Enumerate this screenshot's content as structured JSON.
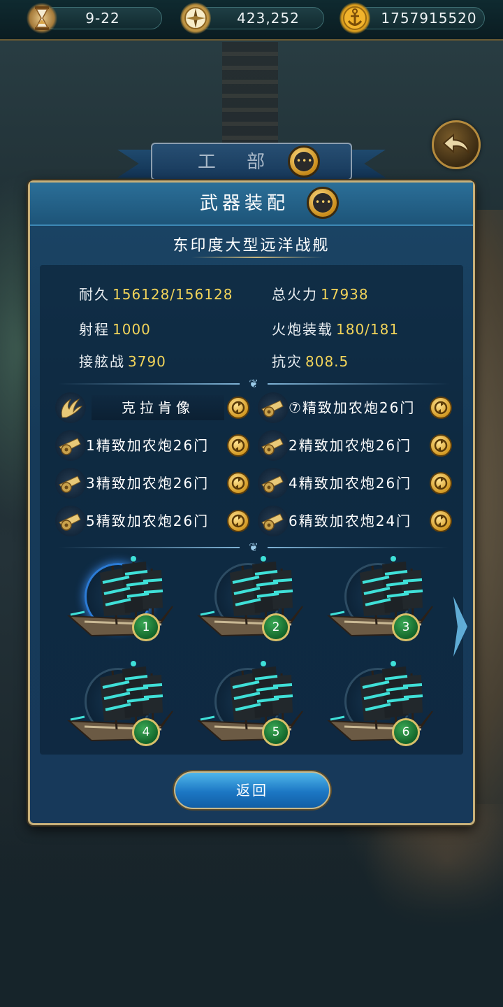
{
  "topbar": {
    "date": "9-22",
    "gold": "423,252",
    "anchors": "1757915520"
  },
  "department": {
    "title": "工 部"
  },
  "panel": {
    "title": "武器装配",
    "ship_name": "东印度大型远洋战舰",
    "stats": {
      "durability_label": "耐久",
      "durability_value": "156128/156128",
      "firepower_label": "总火力",
      "firepower_value": "17938",
      "range_label": "射程",
      "range_value": "1000",
      "cannon_label": "火炮装载",
      "cannon_value": "180/181",
      "boarding_label": "接舷战",
      "boarding_value": "3790",
      "disaster_label": "抗灾",
      "disaster_value": "808.5"
    },
    "slots": [
      {
        "label": "克拉肯像",
        "icon": "wing-icon"
      },
      {
        "label": "⑦精致加农炮26门",
        "icon": "cannon-icon"
      },
      {
        "label": "1精致加农炮26门",
        "icon": "cannon-icon"
      },
      {
        "label": "2精致加农炮26门",
        "icon": "cannon-icon"
      },
      {
        "label": "3精致加农炮26门",
        "icon": "cannon-icon"
      },
      {
        "label": "4精致加农炮26门",
        "icon": "cannon-icon"
      },
      {
        "label": "5精致加农炮26门",
        "icon": "cannon-icon"
      },
      {
        "label": "6精致加农炮24门",
        "icon": "cannon-icon"
      }
    ],
    "ships": [
      {
        "number": "1",
        "selected": true
      },
      {
        "number": "2",
        "selected": false
      },
      {
        "number": "3",
        "selected": false
      },
      {
        "number": "4",
        "selected": false
      },
      {
        "number": "5",
        "selected": false
      },
      {
        "number": "6",
        "selected": false
      }
    ],
    "return_label": "返回"
  },
  "colors": {
    "accent_gold": "#f2d45a",
    "panel_blue": "#1b4566",
    "frame_gold": "#c7b07a",
    "sail_cyan": "#3fe0d8"
  }
}
